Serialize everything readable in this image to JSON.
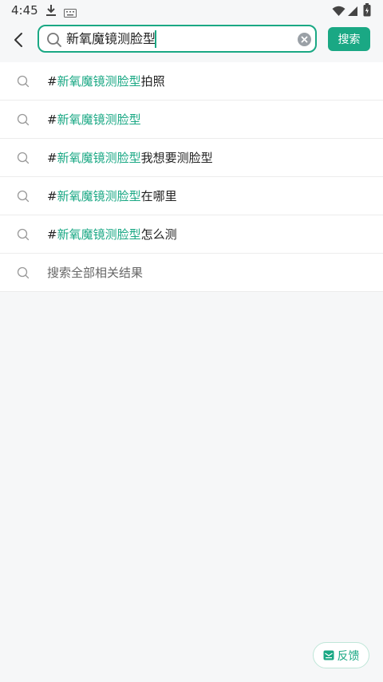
{
  "status_bar": {
    "time": "4:45"
  },
  "search": {
    "query": "新氧魔镜测脸型",
    "button_label": "搜索"
  },
  "suggestions": [
    {
      "prefix": "#",
      "highlight": "新氧魔镜测脸型",
      "suffix": "拍照"
    },
    {
      "prefix": "#",
      "highlight": "新氧魔镜测脸型",
      "suffix": ""
    },
    {
      "prefix": "#",
      "highlight": "新氧魔镜测脸型",
      "suffix": "我想要测脸型"
    },
    {
      "prefix": "#",
      "highlight": "新氧魔镜测脸型",
      "suffix": "在哪里"
    },
    {
      "prefix": "#",
      "highlight": "新氧魔镜测脸型",
      "suffix": "怎么测"
    }
  ],
  "search_all": "搜索全部相关结果",
  "feedback_label": "反馈",
  "colors": {
    "accent": "#1aa884",
    "background": "#f6f7f8"
  },
  "icons": [
    "download-icon",
    "keyboard-icon",
    "wifi-icon",
    "signal-icon",
    "battery-icon",
    "back-arrow-icon",
    "search-icon",
    "clear-icon",
    "mail-icon"
  ]
}
